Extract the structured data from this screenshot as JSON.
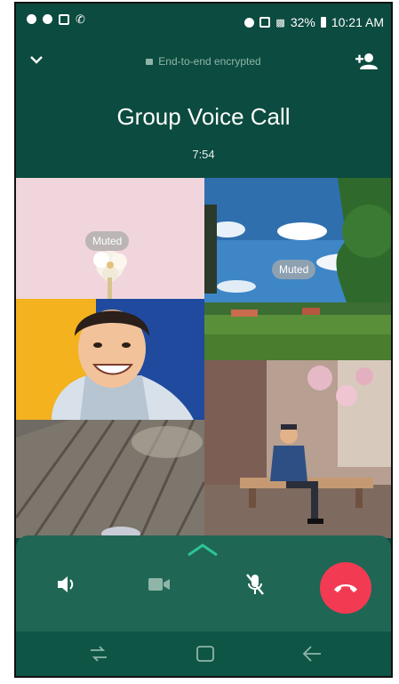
{
  "status_bar": {
    "battery": "32%",
    "time": "10:21 AM"
  },
  "header": {
    "encryption_label": "End-to-end encrypted",
    "title": "Group Voice Call",
    "duration": "7:54"
  },
  "participants": [
    {
      "muted_label": "Muted"
    },
    {
      "muted_label": "Muted"
    }
  ],
  "colors": {
    "header_bg": "#0c4b3f",
    "controls_bg": "#1f6655",
    "accent_green": "#2cc49a",
    "end_call_red": "#f23b52"
  },
  "icons": {
    "collapse": "chevron-down-icon",
    "add_participant": "add-person-icon",
    "speaker": "speaker-icon",
    "video": "video-icon",
    "mic": "mic-off-icon",
    "end_call": "end-call-icon"
  }
}
